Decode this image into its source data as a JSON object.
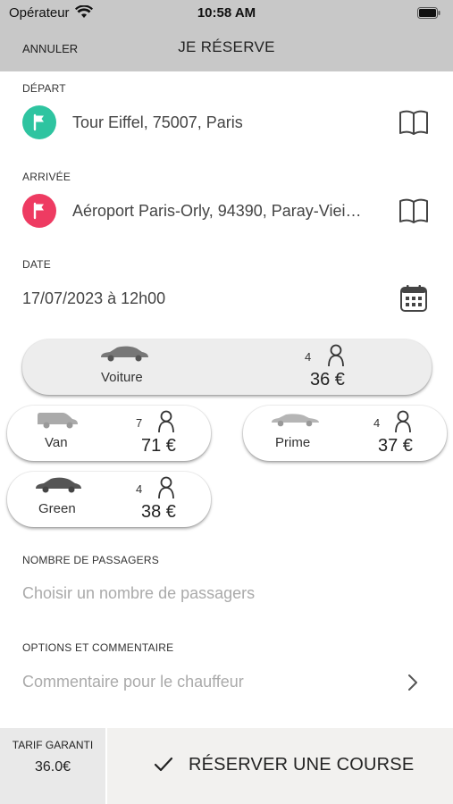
{
  "status_bar": {
    "carrier": "Opérateur",
    "time": "10:58 AM"
  },
  "nav": {
    "cancel_label": "ANNULER",
    "title": "JE RÉSERVE"
  },
  "depart": {
    "label": "DÉPART",
    "address": "Tour Eiffel, 75007, Paris",
    "pin_color": "#2ec4a0"
  },
  "arrivee": {
    "label": "ARRIVÉE",
    "address": "Aéroport Paris-Orly, 94390, Paray-Viei…",
    "pin_color": "#ee3b62"
  },
  "date": {
    "label": "DATE",
    "value": "17/07/2023 à 12h00"
  },
  "vehicles": [
    {
      "name": "Voiture",
      "seats": "4",
      "price": "36 €",
      "selected": true
    },
    {
      "name": "Van",
      "seats": "7",
      "price": "71 €",
      "selected": false
    },
    {
      "name": "Prime",
      "seats": "4",
      "price": "37 €",
      "selected": false
    },
    {
      "name": "Green",
      "seats": "4",
      "price": "38 €",
      "selected": false
    }
  ],
  "passengers": {
    "label": "NOMBRE DE PASSAGERS",
    "placeholder": "Choisir un nombre de passagers"
  },
  "options": {
    "label": "OPTIONS ET COMMENTAIRE",
    "placeholder": "Commentaire pour le chauffeur"
  },
  "footer": {
    "tarif_label": "TARIF GARANTI",
    "tarif_value": "36.0€",
    "book_label": "RÉSERVER UNE COURSE"
  },
  "icons": {
    "depart_pin": "flag-icon",
    "arrive_pin": "flag-icon",
    "map": "book-map-icon",
    "calendar": "calendar-icon",
    "person": "person-icon",
    "car": "car-icon",
    "chevron": "chevron-right-icon",
    "check": "checkmark-icon"
  }
}
